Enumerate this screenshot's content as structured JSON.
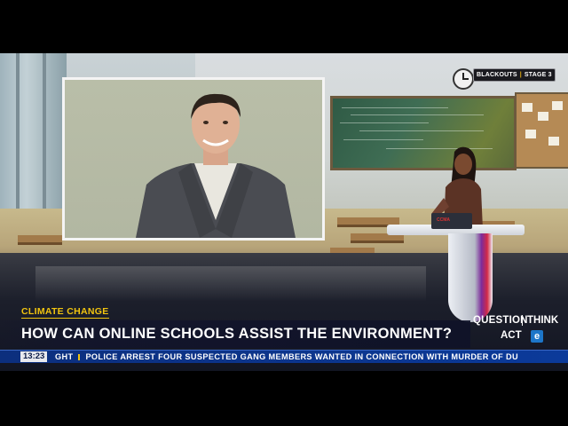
{
  "overlay": {
    "blackouts_label": "BLACKOUTS",
    "blackouts_stage": "STAGE 3"
  },
  "lower_third": {
    "category": "CLIMATE CHANGE",
    "headline": "HOW CAN ONLINE SCHOOLS ASSIST THE ENVIRONMENT?",
    "brand": {
      "question": "QUESTION",
      "think": "THINK",
      "act": "ACT",
      "logo_letter": "e"
    }
  },
  "ticker": {
    "time": "13:23",
    "prev_tail": "GHT",
    "text": "POLICE ARREST FOUR SUSPECTED GANG MEMBERS WANTED IN CONNECTION WITH MURDER OF DU"
  },
  "studio": {
    "laptop_label": "CCMA"
  },
  "colors": {
    "accent_yellow": "#f1c40f",
    "ticker_blue": "#0b3a9a",
    "brand_blue": "#1d76c9"
  }
}
